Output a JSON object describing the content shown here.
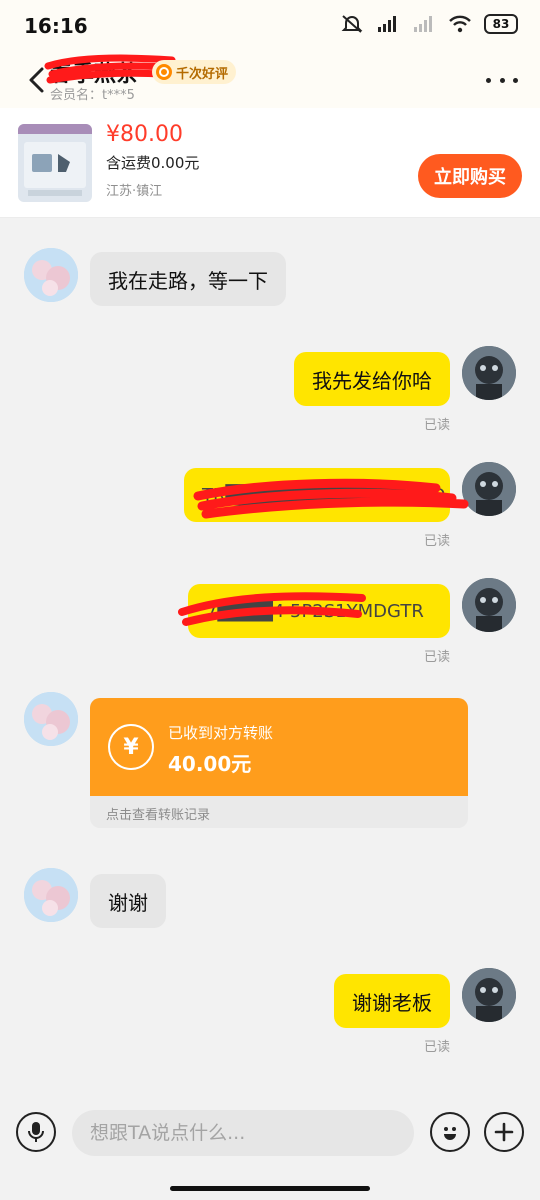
{
  "status_bar": {
    "time": "16:16",
    "battery": "83"
  },
  "header": {
    "seller_name": "春季燕茶",
    "review_badge": "千次好评",
    "member_label": "会员名：t***5"
  },
  "product": {
    "price": "¥80.00",
    "shipping": "含运费0.00元",
    "location": "江苏·镇江",
    "buy_label": "立即购买"
  },
  "messages": [
    {
      "side": "left",
      "text": "我在走路，等一下"
    },
    {
      "side": "right",
      "text": "我先发给你哈",
      "read": "已读"
    },
    {
      "side": "right",
      "text": "TR█████████████DXD",
      "read": "已读"
    },
    {
      "side": "right",
      "text": "7████4 5P2S1YMDGTR",
      "read": "已读"
    },
    {
      "side": "left",
      "transfer": {
        "title": "已收到对方转账",
        "amount": "40.00元",
        "footer": "点击查看转账记录"
      }
    },
    {
      "side": "left",
      "text": "谢谢"
    },
    {
      "side": "right",
      "text": "谢谢老板",
      "read": "已读"
    }
  ],
  "input": {
    "placeholder": "想跟TA说点什么..."
  },
  "icons": {
    "back": "chevron-left-icon",
    "more": "more-dots-icon",
    "mic": "microphone-icon",
    "emoji": "emoji-icon",
    "plus": "plus-icon"
  },
  "colors": {
    "accent_yellow": "#ffe500",
    "buy_button": "#ff5a1f",
    "price": "#ff3c2a",
    "transfer": "#ff9d1c",
    "redaction": "#ff1a1a"
  }
}
